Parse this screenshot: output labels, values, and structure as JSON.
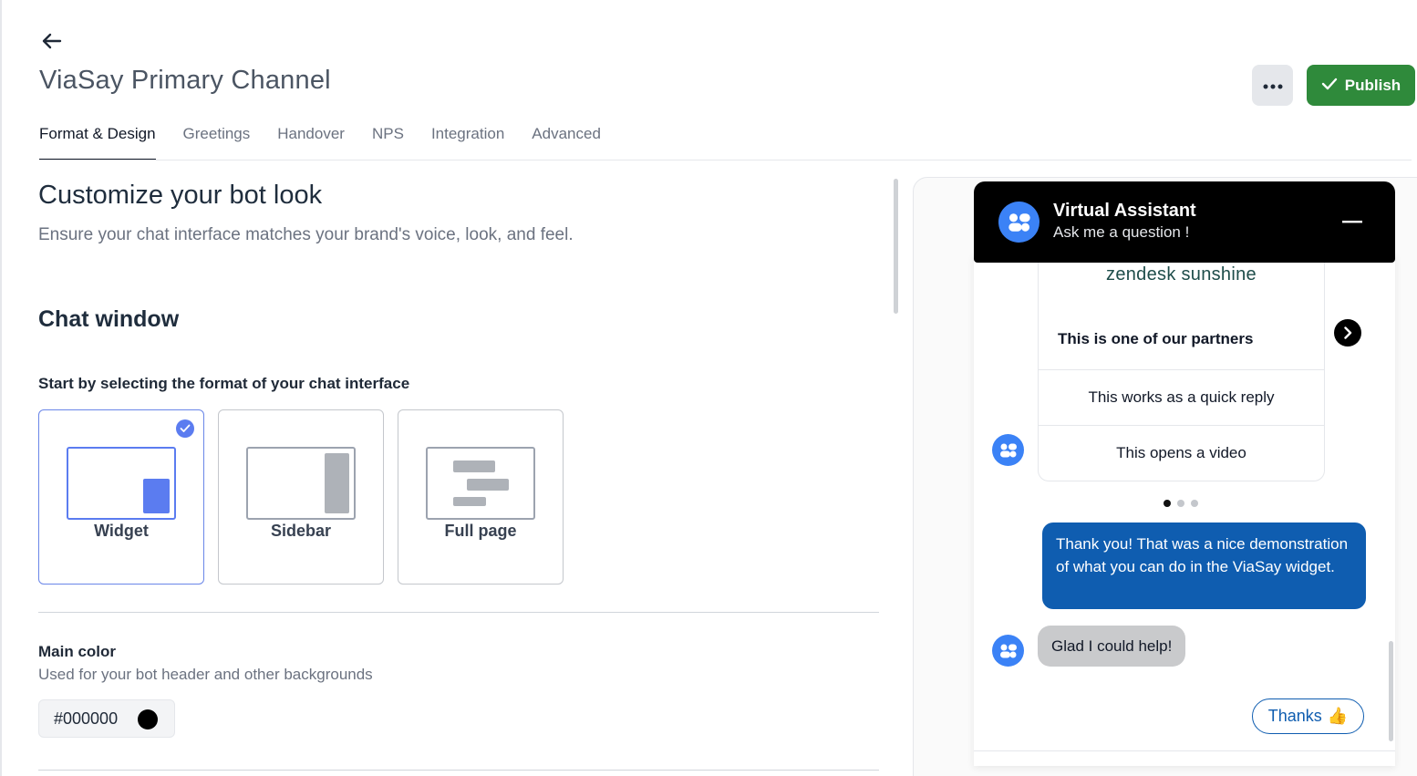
{
  "page": {
    "title": "ViaSay Primary Channel",
    "publish_label": "Publish"
  },
  "tabs": [
    {
      "label": "Format & Design",
      "active": true
    },
    {
      "label": "Greetings"
    },
    {
      "label": "Handover"
    },
    {
      "label": "NPS"
    },
    {
      "label": "Integration"
    },
    {
      "label": "Advanced"
    }
  ],
  "content": {
    "section_title": "Customize your bot look",
    "section_description": "Ensure your chat interface matches your brand's voice, look, and feel.",
    "chat_window_title": "Chat window",
    "format_prompt": "Start by selecting the format of your chat interface",
    "formats": [
      {
        "label": "Widget",
        "selected": true
      },
      {
        "label": "Sidebar",
        "selected": false
      },
      {
        "label": "Full page",
        "selected": false
      }
    ],
    "main_color": {
      "label": "Main color",
      "description": "Used for your bot header and other backgrounds",
      "value": "#000000",
      "swatch_color": "#000000"
    }
  },
  "preview": {
    "header_title": "Virtual Assistant",
    "header_subtitle": "Ask me a question !",
    "carousel": {
      "logo_text": "zendesk sunshine",
      "title": "This is one of our partners",
      "quick_replies": [
        "This works as a quick reply",
        "This opens a video"
      ],
      "page_count": 3,
      "active_page": 1
    },
    "messages": [
      {
        "from": "user",
        "text": "Thank you! That was a nice demonstration of what you can do in the ViaSay widget."
      },
      {
        "from": "bot",
        "text": "Glad I could help!"
      }
    ],
    "suggestion": {
      "label": "Thanks",
      "emoji": "👍"
    }
  },
  "colors": {
    "brand_blue": "#0f5db0",
    "avatar_blue": "#3b82f6",
    "publish_green": "#2f8a3b",
    "selection_blue": "#5b7cf0"
  }
}
